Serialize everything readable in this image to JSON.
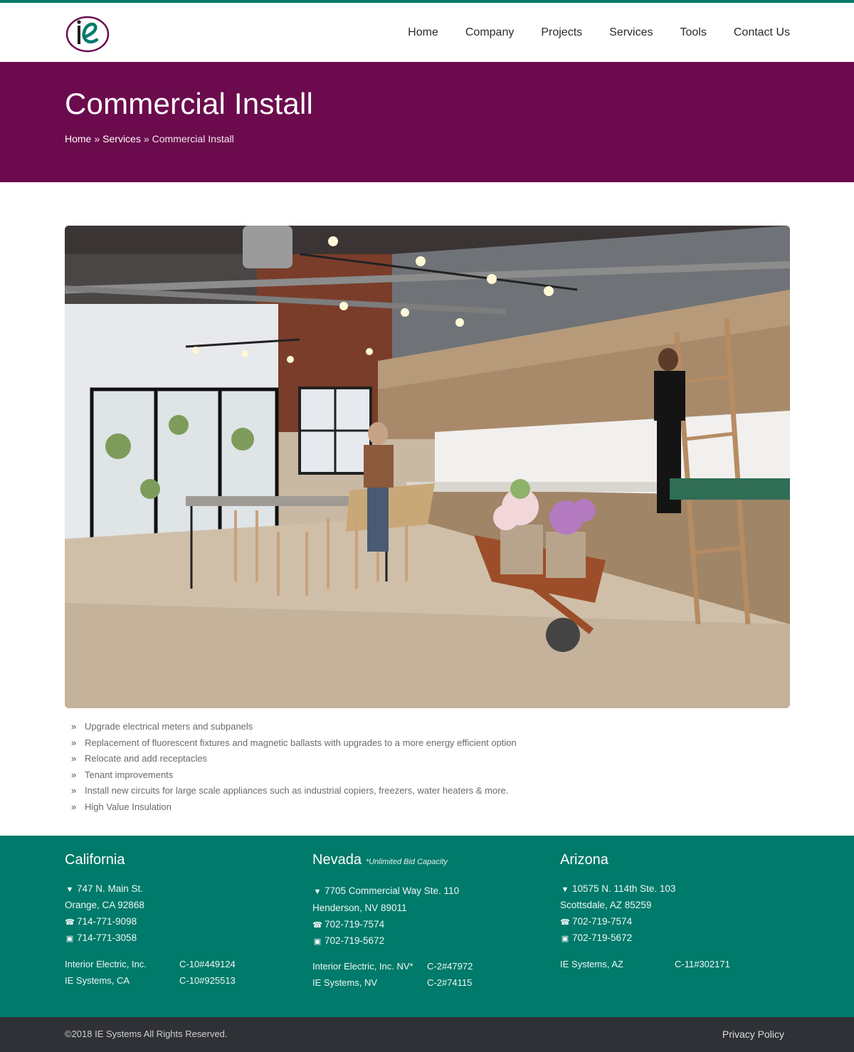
{
  "brand": {
    "logo_text": "ie",
    "accent_color": "#007a6a",
    "banner_color": "#6b0b4d",
    "footer_bottom_color": "#2f3137"
  },
  "nav": {
    "items": [
      "Home",
      "Company",
      "Projects",
      "Services",
      "Tools",
      "Contact Us"
    ]
  },
  "banner": {
    "title": "Commercial Install",
    "breadcrumb": [
      "Home",
      "Services",
      "Commercial Install"
    ],
    "separator": "»"
  },
  "features": [
    "Upgrade electrical meters and subpanels",
    "Replacement of fluorescent fixtures and magnetic ballasts with upgrades to a more energy efficient option",
    "Relocate and add receptacles",
    "Tenant improvements",
    "Install new circuits for large scale appliances such as industrial copiers, freezers, water heaters & more.",
    "High Value Insulation"
  ],
  "footer": {
    "california": {
      "title": "California",
      "address1": "747 N. Main St.",
      "address2": "Orange, CA 92868",
      "phone": "714-771-9098",
      "fax": "714-771-3058",
      "licenses": [
        {
          "name": "Interior Electric, Inc.",
          "number": "C-10#449124"
        },
        {
          "name": "IE Systems, CA",
          "number": "C-10#925513"
        }
      ]
    },
    "nevada": {
      "title": "Nevada",
      "note": "*Unlimited Bid Capacity",
      "address1": "7705 Commercial Way Ste. 110",
      "address2": "Henderson, NV 89011",
      "phone": "702-719-7574",
      "fax": "702-719-5672",
      "licenses": [
        {
          "name": "Interior Electric, Inc. NV*",
          "number": "C-2#47972"
        },
        {
          "name": "IE Systems, NV",
          "number": "C-2#74115"
        }
      ]
    },
    "arizona": {
      "title": "Arizona",
      "address1": "10575 N. 114th Ste. 103",
      "address2": "Scottsdale, AZ 85259",
      "phone": "702-719-7574",
      "fax": "702-719-5672",
      "licenses": [
        {
          "name": "IE Systems, AZ",
          "number": "C-11#302171"
        }
      ]
    }
  },
  "bottom": {
    "copyright": "©2018 IE Systems All Rights Reserved.",
    "privacy": "Privacy Policy"
  }
}
